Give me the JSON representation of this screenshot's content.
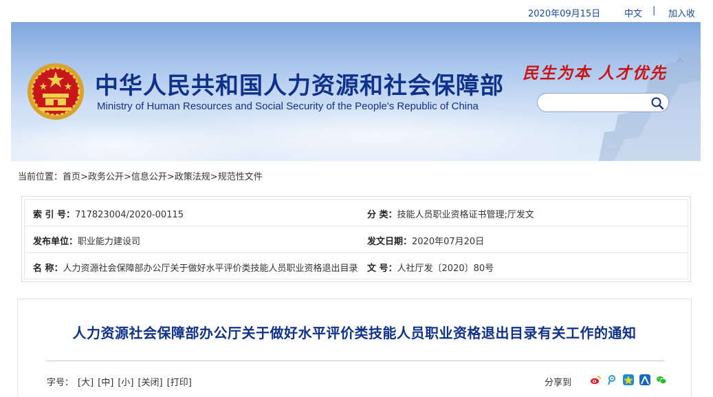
{
  "topbar": {
    "date": "2020年09月15日",
    "lang": "中文",
    "sep": "|",
    "favorite": "加入收藏"
  },
  "header": {
    "title_cn": "中华人民共和国人力资源和社会保障部",
    "title_en": "Ministry of Human Resources and Social Security of the People's Republic of China",
    "slogan": "民生为本 人才优先",
    "search_placeholder": ""
  },
  "breadcrumb": {
    "prefix": "当前位置：",
    "items": [
      "首页",
      "政务公开",
      "信息公开",
      "政策法规",
      "规范性文件"
    ],
    "separator": ">"
  },
  "info": {
    "index_label": "索 引 号：",
    "index_value": "717823004/2020-00115",
    "category_label": "分 类：",
    "category_value": "技能人员职业资格证书管理;厅发文",
    "publisher_label": "发布单位：",
    "publisher_value": "职业能力建设司",
    "date_label": "发文日期：",
    "date_value": "2020年07月20日",
    "name_label": "名 称：",
    "name_value": "人力资源社会保障部办公厅关于做好水平评价类技能人员职业资格退出目录有关工作的通知",
    "docno_label": "文 号：",
    "docno_value": "人社厅发〔2020〕80号"
  },
  "article": {
    "title": "人力资源社会保障部办公厅关于做好水平评价类技能人员职业资格退出目录有关工作的通知",
    "fontsize_label": "字号：",
    "fontsize_opts": [
      "[大]",
      "[中]",
      "[小]",
      "[关闭]",
      "[打印]"
    ],
    "share_label": "分享到"
  },
  "colors": {
    "brand_blue": "#10318a",
    "slogan_red": "#c81414",
    "link_blue": "#1a4aa0"
  },
  "icons": [
    "search-icon",
    "national-emblem",
    "weibo-icon",
    "tencent-weibo-icon",
    "qzone-icon",
    "renren-icon",
    "wechat-icon"
  ]
}
